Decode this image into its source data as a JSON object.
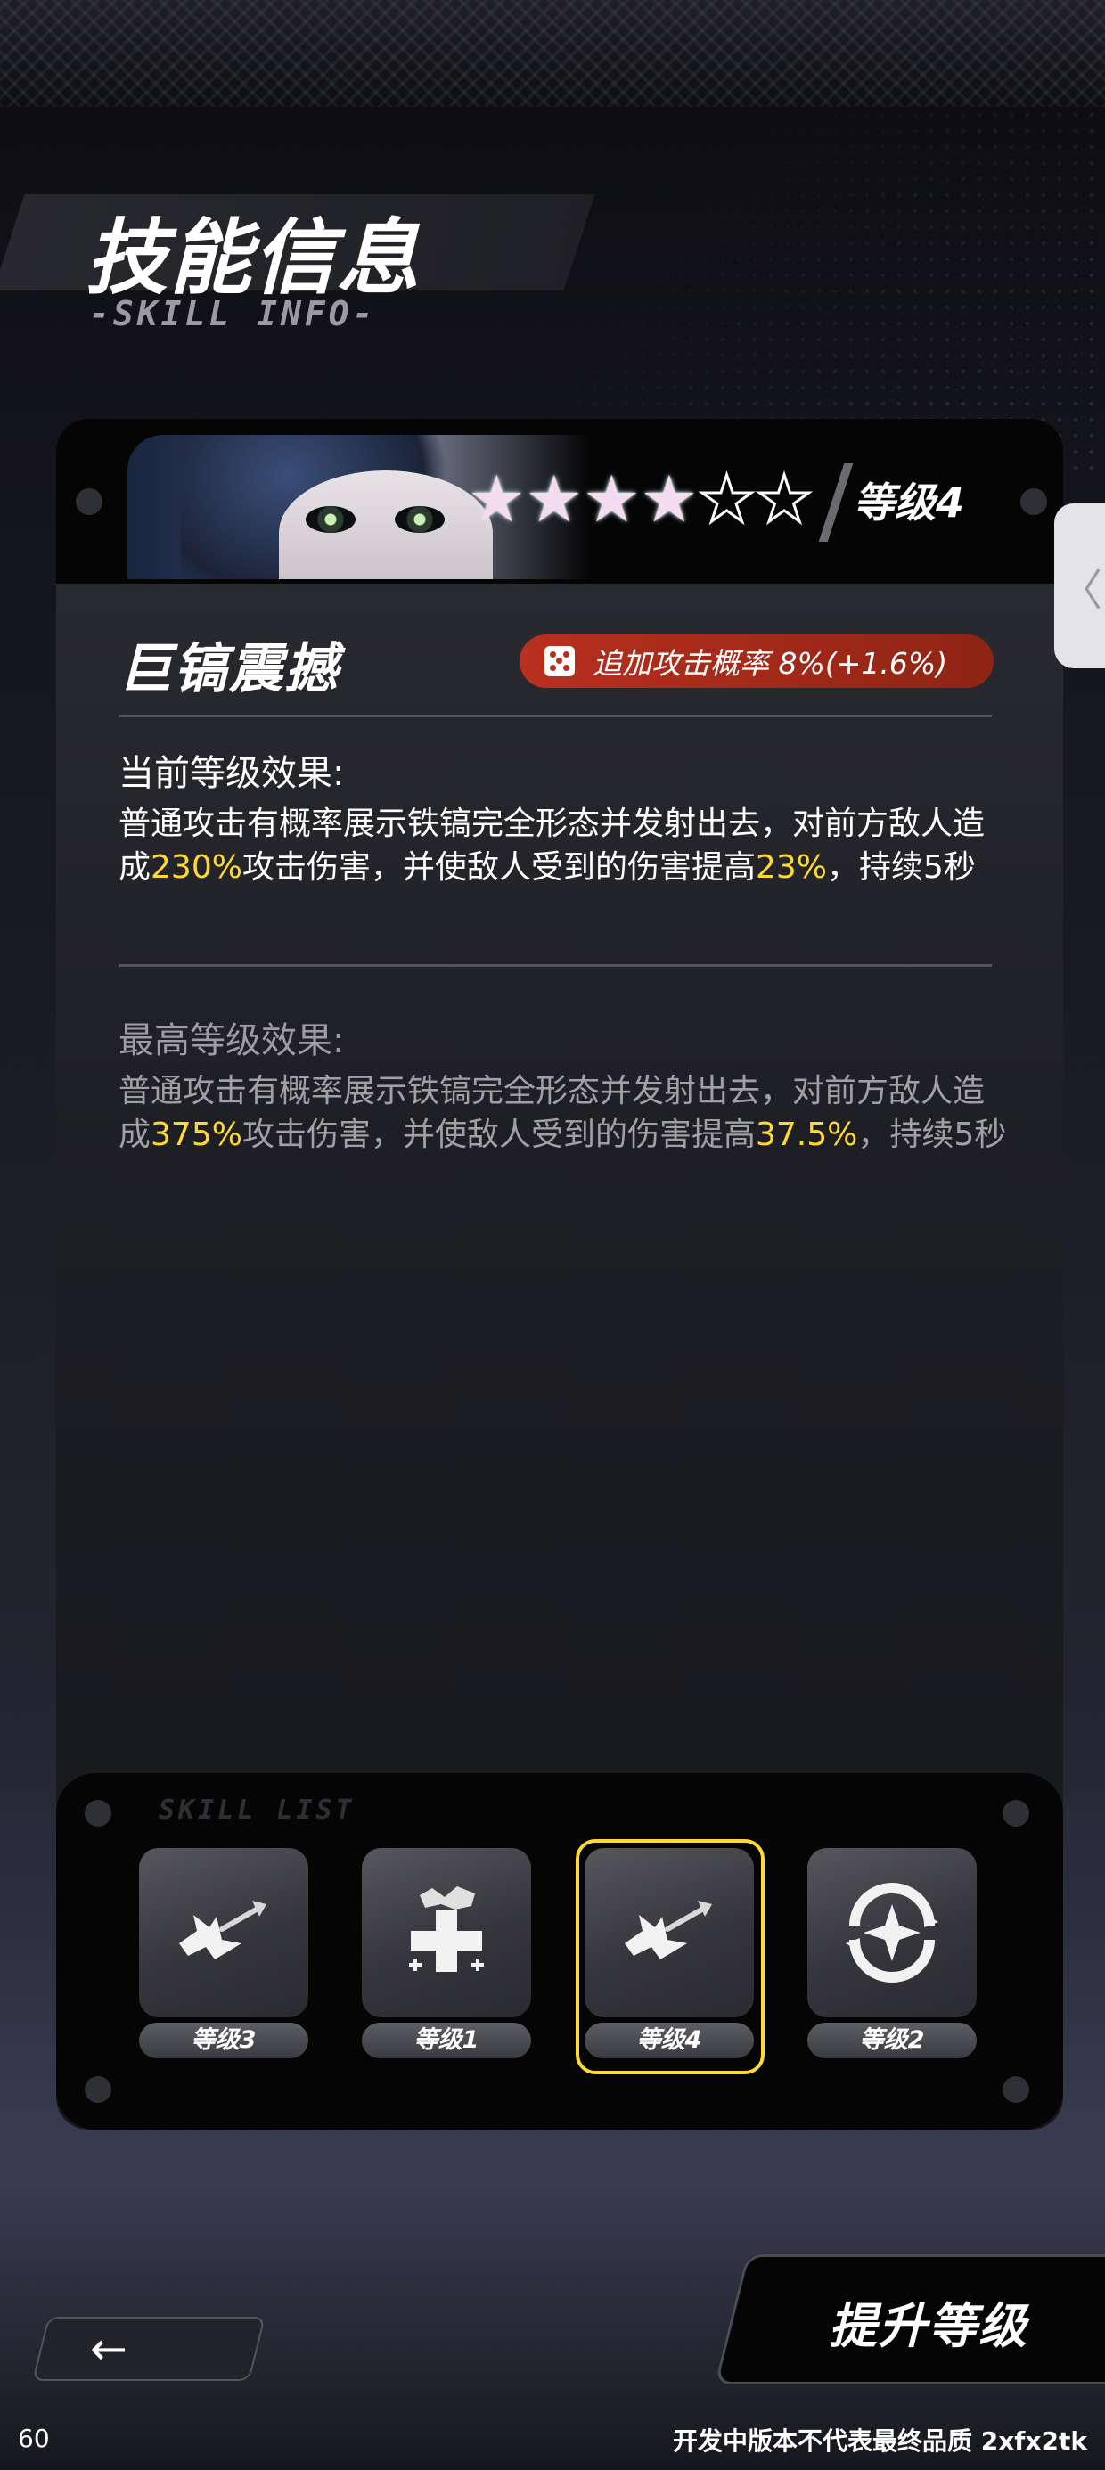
{
  "page": {
    "title": "技能信息",
    "subtitle": "-SKILL INFO-"
  },
  "skill_card": {
    "star_rating": {
      "filled": 4,
      "total": 6
    },
    "level": "等级4",
    "name": "巨镐震撼",
    "badge": {
      "icon": "dice-icon",
      "label": "追加攻击概率  8%(+1.6%)"
    },
    "current_effect": {
      "title": "当前等级效果:",
      "text_parts": [
        "普通攻击有概率展示铁镐完全形态并发射出去，对前方敌人造成",
        "230%",
        "攻击伤害，并使敌人受到的伤害提高",
        "23%",
        "，持续5秒"
      ]
    },
    "max_effect": {
      "title": "最高等级效果:",
      "text_parts": [
        "普通攻击有概率展示铁镐完全形态并发射出去，对前方敌人造成",
        "375%",
        "攻击伤害，并使敌人受到的伤害提高",
        "37.5%",
        "，持续5秒"
      ]
    }
  },
  "skill_list": {
    "watermark": "SKILL LIST",
    "items": [
      {
        "icon": "pickaxe-shock-icon",
        "label": "等级3",
        "selected": false
      },
      {
        "icon": "cross-pop-icon",
        "label": "等级1",
        "selected": false
      },
      {
        "icon": "pickaxe-shock-icon",
        "label": "等级4",
        "selected": true
      },
      {
        "icon": "crosshair-ring-icon",
        "label": "等级2",
        "selected": false
      }
    ]
  },
  "side_tab": {
    "glyph": "〈"
  },
  "bottom": {
    "back_glyph": "←",
    "upgrade_label": "提升等级",
    "fps": "60",
    "disclaimer": "开发中版本不代表最终品质 2xfx2tk"
  },
  "colors": {
    "highlight": "#ffd92e",
    "badge_red": "#b8301f",
    "selected_frame": "#ffd92e"
  }
}
